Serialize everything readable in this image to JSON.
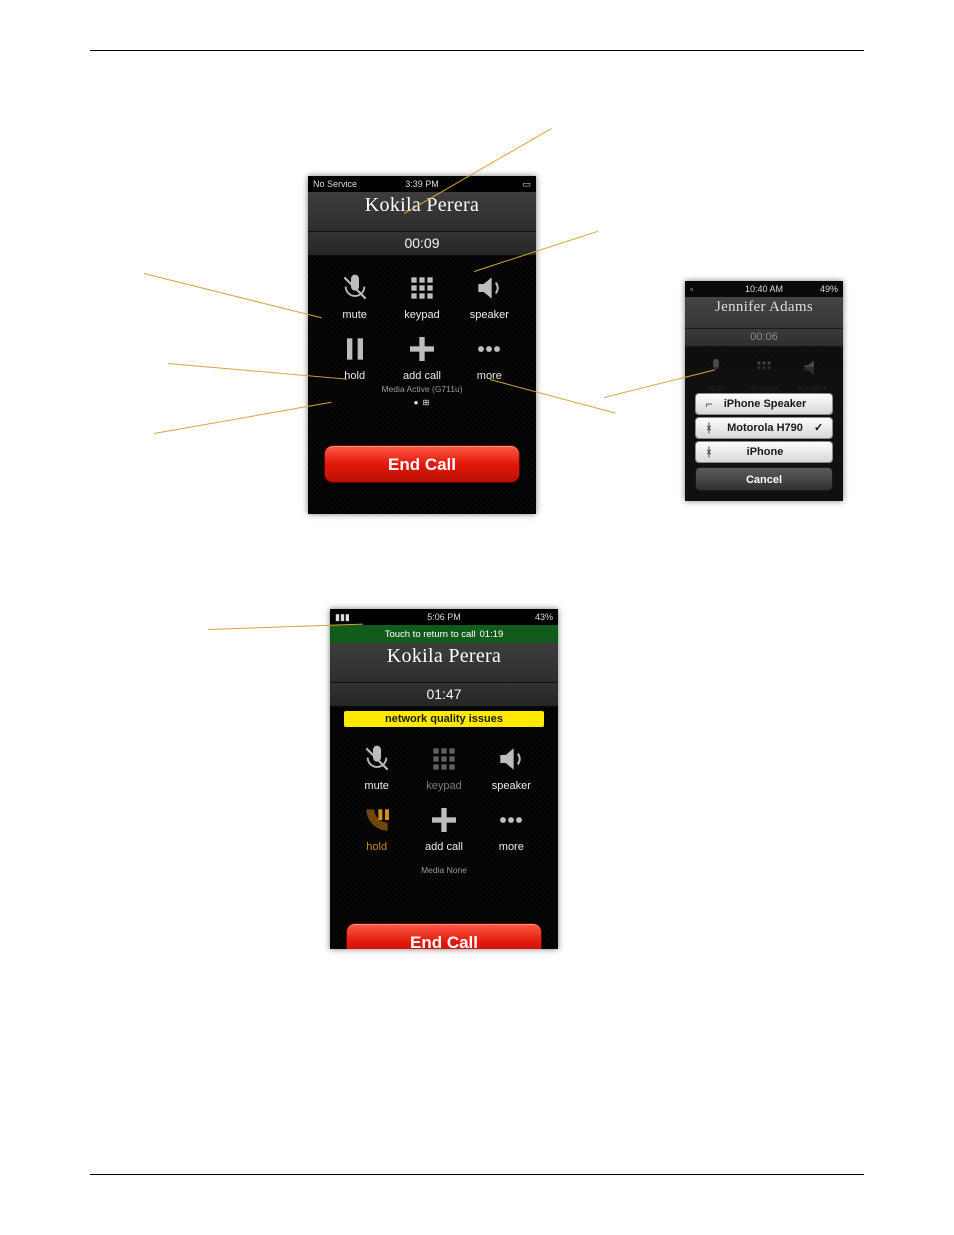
{
  "phone1": {
    "status": {
      "left": "No Service",
      "time": "3:39 PM"
    },
    "caller": "Kokila Perera",
    "timer": "00:09",
    "buttons": {
      "mute": "mute",
      "keypad": "keypad",
      "speaker": "speaker",
      "hold": "hold",
      "addcall": "add call",
      "more": "more"
    },
    "media": "Media Active (G711u)",
    "dots": "●  ⊞",
    "endcall": "End Call"
  },
  "phone2": {
    "status": {
      "time": "10:40 AM",
      "right": "49%"
    },
    "caller": "Jennifer Adams",
    "timer": "00:06",
    "buttons": {
      "mute": "mute",
      "keypad": "keypad",
      "speaker": "speaker"
    },
    "routes": {
      "speaker": "iPhone Speaker",
      "bt": "Motorola H790",
      "iphone": "iPhone",
      "cancel": "Cancel"
    }
  },
  "phone3": {
    "status": {
      "time": "5:06 PM",
      "right": "43%"
    },
    "greenbar": {
      "text": "Touch to return to call",
      "time": "01:19"
    },
    "caller": "Kokila Perera",
    "timer": "01:47",
    "nqi": "network quality issues",
    "buttons": {
      "mute": "mute",
      "keypad": "keypad",
      "speaker": "speaker",
      "hold": "hold",
      "addcall": "add call",
      "more": "more"
    },
    "media": "Media None",
    "endcall": "End Call"
  }
}
